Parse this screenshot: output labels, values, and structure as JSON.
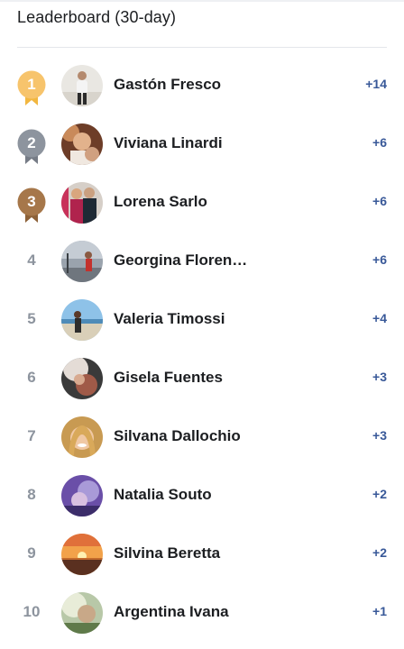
{
  "header": {
    "title": "Leaderboard (30-day)"
  },
  "colors": {
    "gold": "#f7c46c",
    "silver": "#8d949e",
    "bronze": "#a6774a",
    "score": "#385898"
  },
  "entries": [
    {
      "rank": "1",
      "name": "Gastón Fresco",
      "score": "+14",
      "medal": "gold"
    },
    {
      "rank": "2",
      "name": "Viviana Linardi",
      "score": "+6",
      "medal": "silver"
    },
    {
      "rank": "3",
      "name": "Lorena Sarlo",
      "score": "+6",
      "medal": "bronze"
    },
    {
      "rank": "4",
      "name": "Georgina Floren…",
      "score": "+6",
      "medal": ""
    },
    {
      "rank": "5",
      "name": "Valeria Timossi",
      "score": "+4",
      "medal": ""
    },
    {
      "rank": "6",
      "name": "Gisela Fuentes",
      "score": "+3",
      "medal": ""
    },
    {
      "rank": "7",
      "name": "Silvana Dallochio",
      "score": "+3",
      "medal": ""
    },
    {
      "rank": "8",
      "name": "Natalia Souto",
      "score": "+2",
      "medal": ""
    },
    {
      "rank": "9",
      "name": "Silvina Beretta",
      "score": "+2",
      "medal": ""
    },
    {
      "rank": "10",
      "name": "Argentina Ivana",
      "score": "+1",
      "medal": ""
    }
  ]
}
